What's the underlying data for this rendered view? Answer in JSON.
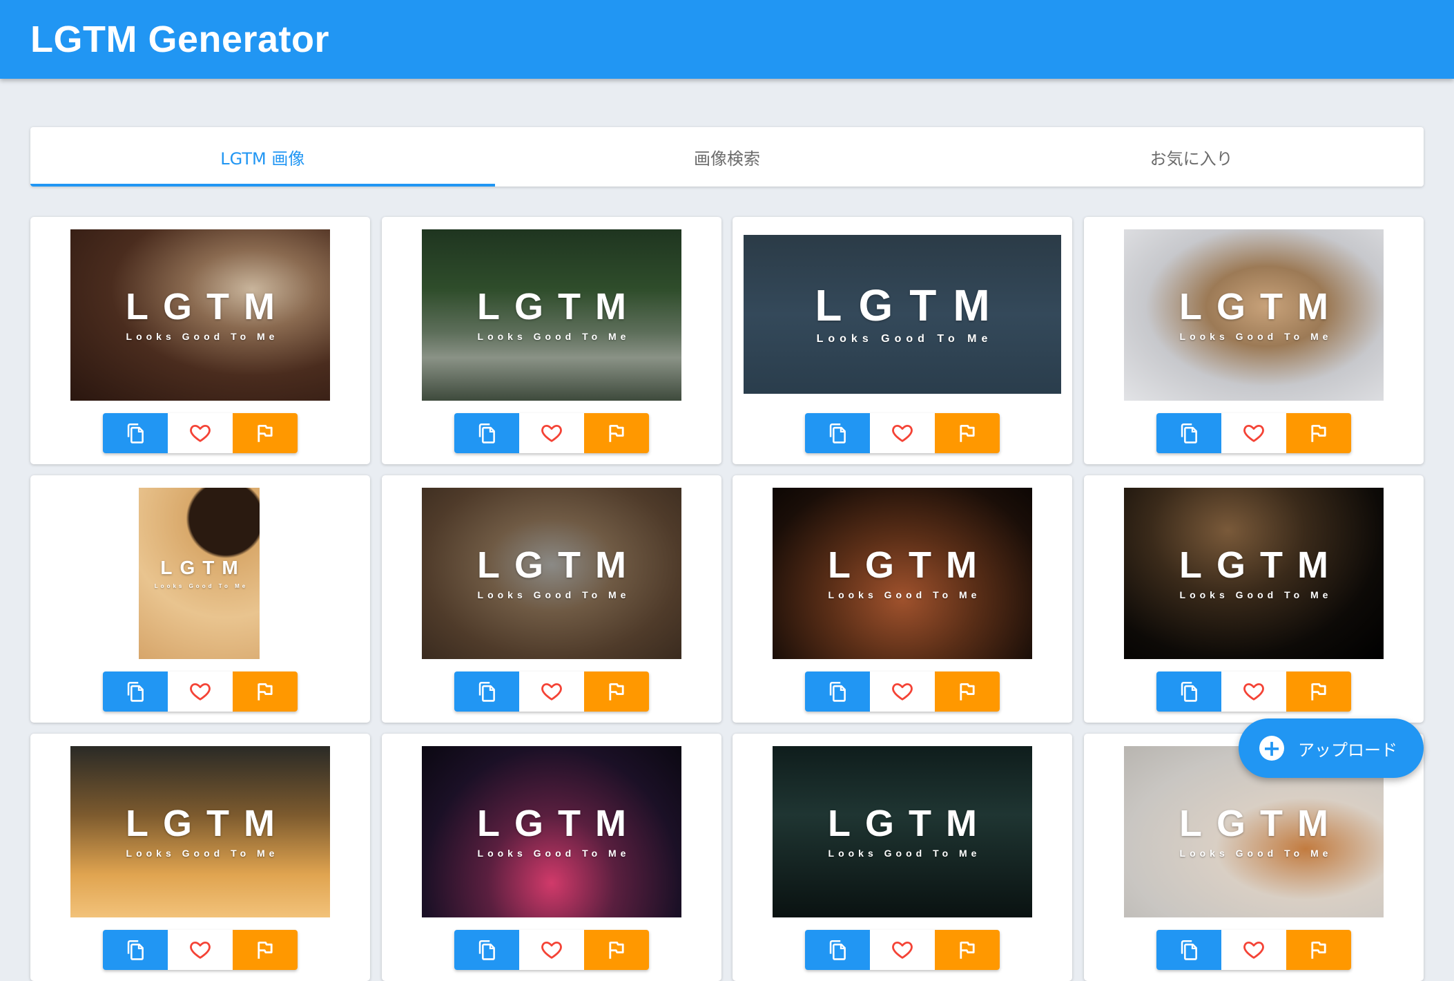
{
  "header": {
    "title": "LGTM Generator"
  },
  "tabs": [
    {
      "label": "LGTM 画像",
      "active": true
    },
    {
      "label": "画像検索",
      "active": false
    },
    {
      "label": "お気に入り",
      "active": false
    }
  ],
  "overlay": {
    "main": "LGTM",
    "sub": "Looks Good To Me"
  },
  "actions": {
    "copy_icon": "copy-icon",
    "favorite_icon": "heart-icon",
    "report_icon": "flag-icon"
  },
  "images": [
    {
      "subject": "pug-puppy"
    },
    {
      "subject": "overgrown-alley"
    },
    {
      "subject": "ship-at-sea"
    },
    {
      "subject": "shiba-dog"
    },
    {
      "subject": "acoustic-guitar"
    },
    {
      "subject": "kitten-in-blanket"
    },
    {
      "subject": "birthday-cake"
    },
    {
      "subject": "dog-in-dark"
    },
    {
      "subject": "bridge-sunset"
    },
    {
      "subject": "neon-lights"
    },
    {
      "subject": "dark-hall-lights"
    },
    {
      "subject": "shiba-closeup"
    }
  ],
  "fab": {
    "label": "アップロード",
    "icon": "plus-icon"
  },
  "colors": {
    "primary": "#2196f3",
    "accent": "#ff9800",
    "favorite": "#f44336",
    "background": "#e9edf2"
  }
}
